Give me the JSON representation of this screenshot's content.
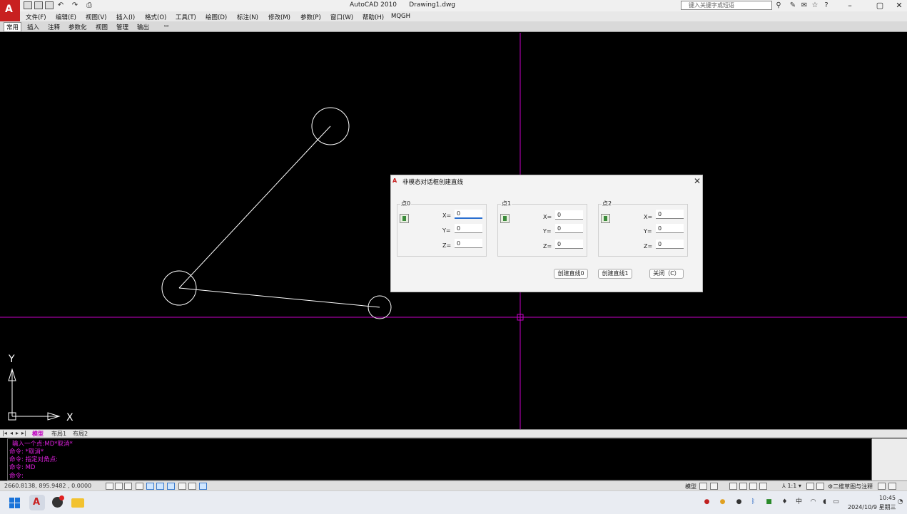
{
  "window": {
    "title": "AutoCAD 2010",
    "document": "Drawing1.dwg",
    "search_placeholder": "键入关键字或短语"
  },
  "menu": [
    "文件(F)",
    "编辑(E)",
    "视图(V)",
    "插入(I)",
    "格式(O)",
    "工具(T)",
    "绘图(D)",
    "标注(N)",
    "修改(M)",
    "参数(P)",
    "窗口(W)",
    "帮助(H)",
    "MQGH"
  ],
  "ribbon_tabs": [
    "常用",
    "插入",
    "注释",
    "参数化",
    "视图",
    "管理",
    "输出"
  ],
  "ucs": {
    "x": "X",
    "y": "Y"
  },
  "colors": {
    "crosshair": "#c800c8",
    "geometry": "#ffffff",
    "command_text": "#e020e0"
  },
  "dialog": {
    "title": "非模态对话框创建直线",
    "groups": [
      {
        "label": "点0",
        "x_label": "X=",
        "y_label": "Y=",
        "z_label": "Z=",
        "x": "0",
        "y": "0",
        "z": "0"
      },
      {
        "label": "点1",
        "x_label": "X=",
        "y_label": "Y=",
        "z_label": "Z=",
        "x": "0",
        "y": "0",
        "z": "0"
      },
      {
        "label": "点2",
        "x_label": "X=",
        "y_label": "Y=",
        "z_label": "Z=",
        "x": "0",
        "y": "0",
        "z": "0"
      }
    ],
    "buttons": [
      "创建直线0",
      "创建直线1",
      "关闭（C）"
    ]
  },
  "layout_tabs": [
    "模型",
    "布局1",
    "布局2"
  ],
  "command_history": [
    "输入一个点:MD*取消*",
    "命令: *取消*",
    "命令: 指定对角点:",
    "命令: MD",
    "命令:"
  ],
  "status": {
    "coordinates": "2660.8138, 895.9482 , 0.0000",
    "model_label": "模型",
    "annotation_scale": "1:1",
    "workspace": "二维草图与注释"
  },
  "taskbar": {
    "time": "10:45",
    "date": "2024/10/9 星期三",
    "ime": "中"
  }
}
